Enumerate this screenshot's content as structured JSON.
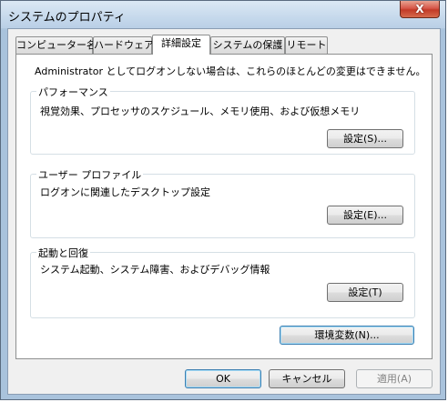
{
  "window": {
    "title": "システムのプロパティ",
    "close_glyph": "X"
  },
  "tabs": [
    {
      "label": "コンピューター名",
      "active": false
    },
    {
      "label": "ハードウェア",
      "active": false
    },
    {
      "label": "詳細設定",
      "active": true
    },
    {
      "label": "システムの保護",
      "active": false
    },
    {
      "label": "リモート",
      "active": false
    }
  ],
  "panel": {
    "intro": "Administrator としてログオンしない場合は、これらのほとんどの変更はできません。",
    "performance": {
      "title": "パフォーマンス",
      "description": "視覚効果、プロセッサのスケジュール、メモリ使用、および仮想メモリ",
      "button": "設定(S)..."
    },
    "user_profile": {
      "title": "ユーザー プロファイル",
      "description": "ログオンに関連したデスクトップ設定",
      "button": "設定(E)..."
    },
    "startup_recovery": {
      "title": "起動と回復",
      "description": "システム起動、システム障害、およびデバッグ情報",
      "button": "設定(T)"
    },
    "env_button": "環境変数(N)..."
  },
  "footer": {
    "ok": "OK",
    "cancel": "キャンセル",
    "apply": "適用(A)"
  }
}
